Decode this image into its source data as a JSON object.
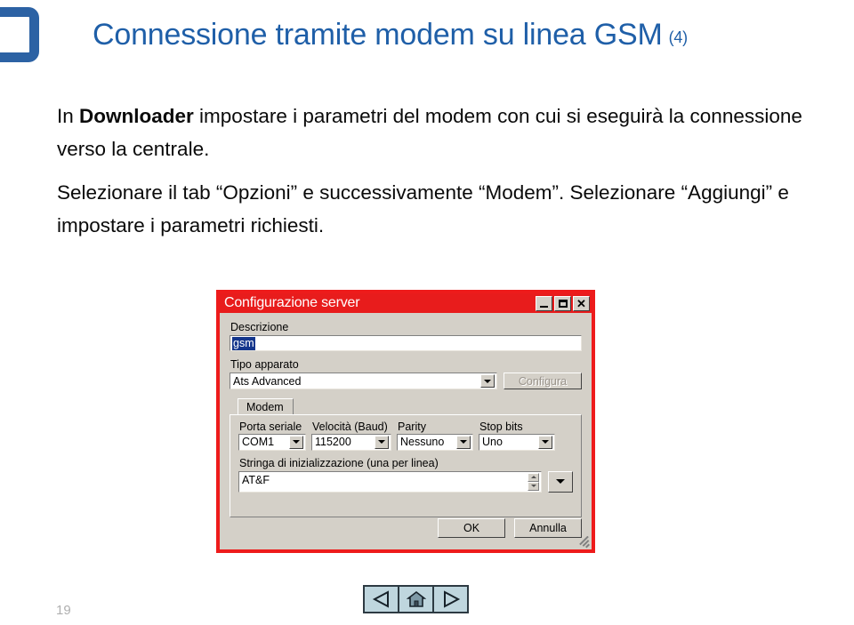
{
  "slide": {
    "logo_icon": "bracket-logo",
    "title": "Connessione tramite modem su linea GSM",
    "title_suffix": "(4)",
    "title_color": "#1F5FA8",
    "page_number": "19",
    "body": {
      "para1_prefix": "In ",
      "para1_bold": "Downloader",
      "para1_rest": " impostare i parametri del modem con cui si eseguirà la connessione verso la centrale.",
      "para2": "Selezionare il tab “Opzioni” e successivamente “Modem”. Selezionare “Aggiungi” e impostare i parametri richiesti."
    }
  },
  "dialog": {
    "title": "Configurazione server",
    "titlebar_color": "#E81C1C",
    "border_color": "#EE1B1B",
    "face_color": "#D4D0C8",
    "titlebar_buttons": [
      {
        "name": "minimize",
        "glyph": "_"
      },
      {
        "name": "maximize",
        "glyph": "□"
      },
      {
        "name": "close",
        "glyph": "✕"
      }
    ],
    "descrizione": {
      "label": "Descrizione",
      "value": "gsm",
      "selected": true,
      "selection_color": "#14368C"
    },
    "tipo_apparato": {
      "label": "Tipo apparato",
      "value": "Ats Advanced",
      "options": [
        "Ats Advanced"
      ]
    },
    "configura_button": {
      "label": "Configura",
      "disabled": true
    },
    "tabs": [
      {
        "label": "Modem",
        "active": true
      }
    ],
    "modem_fields": [
      {
        "label": "Porta seriale",
        "value": "COM1",
        "options": [
          "COM1"
        ]
      },
      {
        "label": "Velocità (Baud)",
        "value": "115200",
        "options": [
          "115200"
        ]
      },
      {
        "label": "Parity",
        "value": "Nessuno",
        "options": [
          "Nessuno"
        ]
      },
      {
        "label": "Stop bits",
        "value": "Uno",
        "options": [
          "Uno"
        ]
      }
    ],
    "init_string": {
      "label": "Stringa di inizializzazione (una per linea)",
      "value": "AT&F"
    },
    "buttons": {
      "ok": "OK",
      "cancel": "Annulla"
    },
    "resize_grip_icon": "resize-grip-icon"
  },
  "nav": {
    "back_icon": "triangle-left-icon",
    "home_icon": "house-icon",
    "forward_icon": "triangle-right-icon",
    "button_fill": "#BFD6DE",
    "button_stroke": "#2D3A42"
  }
}
